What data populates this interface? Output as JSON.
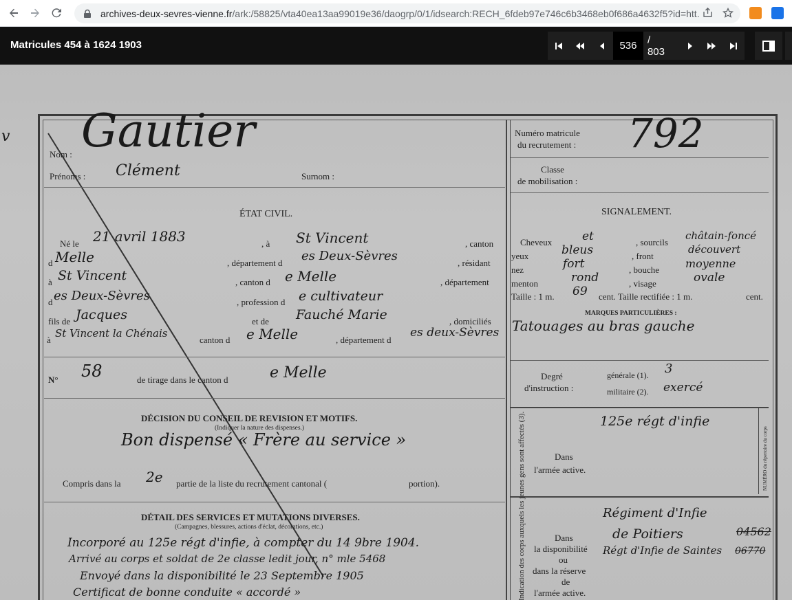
{
  "browser": {
    "url_host": "archives-deux-sevres-vienne.fr",
    "url_path": "/ark:/58825/vta40ea13aa99019e36/daogrp/0/1/idsearch:RECH_6fdeb97e746c6b3468eb0f686a4632f5?id=htt..."
  },
  "viewer": {
    "title": "Matricules 454 à 1624 1903",
    "current_page": "536",
    "total_pages": "/ 803"
  },
  "document": {
    "surname_hand": "Gautier",
    "firstname_hand": "Clément",
    "matricule_hand": "792",
    "labels": {
      "nom": "Nom :",
      "prenoms": "Prénoms :",
      "surnom": "Surnom :",
      "numero_matricule": "Numéro matricule",
      "du_recrutement": "du recrutement :",
      "classe": "Classe",
      "de_mobilisation": "de mobilisation :",
      "etat_civil": "ÉTAT CIVIL.",
      "signalement": "SIGNALEMENT.",
      "ne_le": "Né le",
      "a": ", à",
      "canton": ", canton",
      "de": "d",
      "departement_d": ", département d",
      "resident": ", résidant",
      "a2": "à",
      "canton_d": ", canton d",
      "departement": ", département",
      "d_es": "d",
      "profession_d": ", profession d",
      "fils_de": "fils de",
      "et_de": "et de",
      "domicilies": ", domiciliés",
      "a3": "à",
      "canton_de": "canton d",
      "departement_des": ", département d",
      "no": "N°",
      "tirage": "de tirage dans le canton d",
      "decision": "DÉCISION DU CONSEIL DE REVISION ET MOTIFS.",
      "indiquer": "(Indiquer la nature des dispenses.)",
      "compris": "Compris dans la",
      "partie": "partie de la liste du recrutement cantonal (",
      "portion": "portion).",
      "detail": "DÉTAIL DES SERVICES ET MUTATIONS DIVERSES.",
      "campagnes": "(Campagnes, blessures, actions d'éclat, décorations, etc.)",
      "cheveux": "Cheveux",
      "sourcils": ", sourcils",
      "yeux": "yeux",
      "front": ", front",
      "nez": "nez",
      "bouche": ", bouche",
      "menton": "menton",
      "visage": ", visage",
      "taille": "Taille : 1 m.",
      "cent_taille": "cent. Taille rectifiée : 1 m.",
      "cent": "cent.",
      "marques": "MARQUES PARTICULIÈRES :",
      "degre": "Degré",
      "instruction": "d'instruction :",
      "generale": "générale (1).",
      "militaire": "militaire (2).",
      "affectes": "Indication des corps auxquels les jeunes gens sont affectés (3).",
      "dans": "Dans",
      "armee_active": "l'armée active.",
      "dans2": "Dans",
      "disponibilite": "la disponibilité",
      "ou": "ou",
      "reserve": "dans la réserve",
      "de_ra": "de",
      "armee_active2": "l'armée active.",
      "numero_rep": "NUMÉRO du répertoire du corps"
    },
    "hand": {
      "date_naissance": "21 avril 1883",
      "lieu": "St Vincent",
      "canton_nais": "Melle",
      "dept_nais": "es Deux-Sèvres",
      "residence": "St Vincent",
      "canton_res": "e Melle",
      "dept_res": "es Deux-Sèvres",
      "profession": "e cultivateur",
      "pere": "Jacques",
      "mere": "Fauché Marie",
      "domicile": "St Vincent la Chénais",
      "canton_dom": "e Melle",
      "dept_dom": "es deux-Sèvres",
      "numero_tirage": "58",
      "canton_tirage": "e Melle",
      "decision": "Bon dispensé « Frère au service »",
      "partie": "2e",
      "service_1": "Incorporé au 125e régt d'infie, à compter du 14 9bre 1904.",
      "service_2": "Arrivé au corps et soldat de 2e classe ledit jour, n° mle 5468",
      "service_3": "Envoyé dans la disponibilité le 23 Septembre 1905",
      "service_4": "Certificat de bonne conduite « accordé »",
      "cheveux": "et",
      "sourcils": "châtain-foncé",
      "yeux": "bleus",
      "front": "découvert",
      "nez": "fort",
      "bouche": "moyenne",
      "menton": "rond",
      "visage": "ovale",
      "taille": "69",
      "marques": "Tatouages au bras gauche",
      "generale": "3",
      "militaire": "exercé",
      "corps_active": "125e régt d'infie",
      "corps_dispo_1": "Régiment d'Infie",
      "corps_dispo_2": "de Poitiers",
      "corps_dispo_num": "04562",
      "corps_dispo_3": "Régt d'Infie de Saintes",
      "corps_dispo_num2": "06770"
    }
  }
}
